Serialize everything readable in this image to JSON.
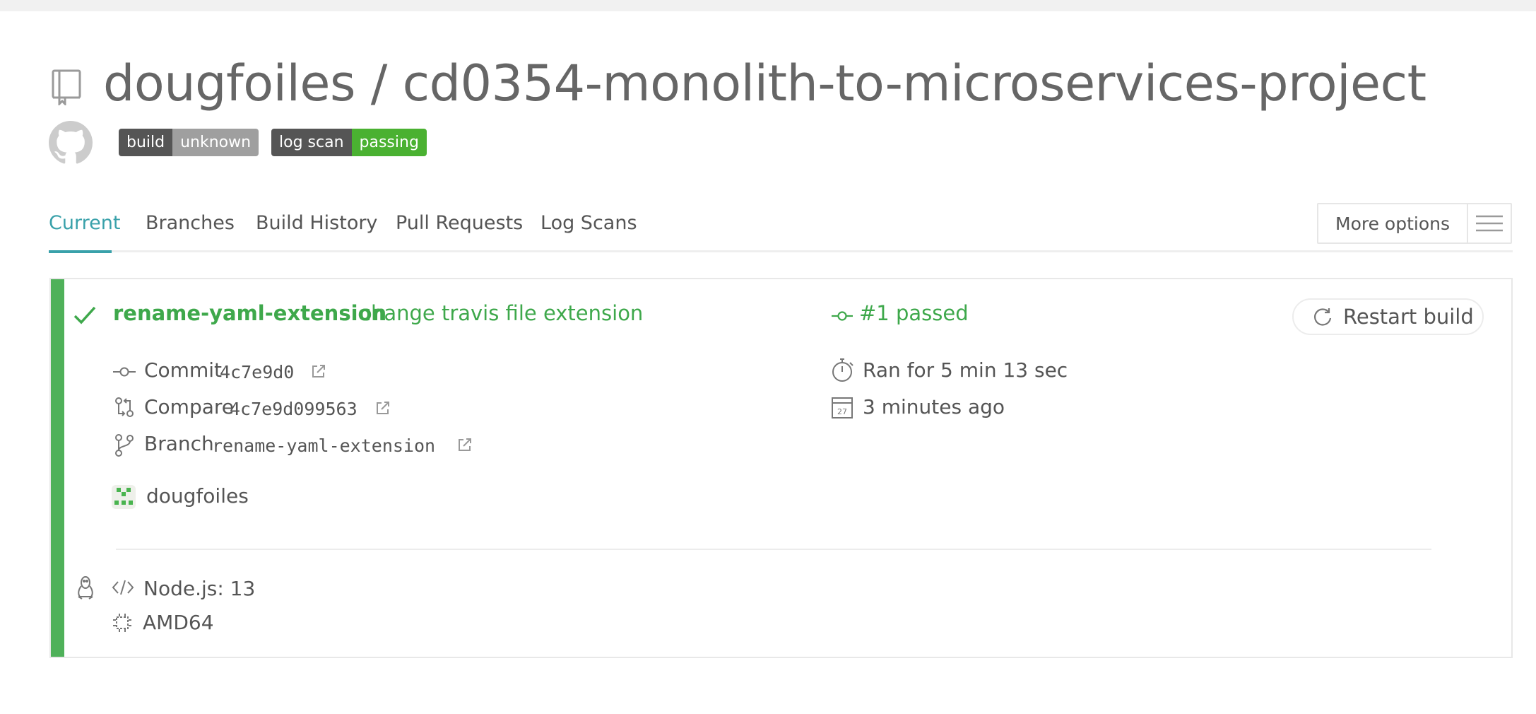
{
  "repo": {
    "owner": "dougfoiles",
    "separator": "/",
    "name": "cd0354-monolith-to-microservices-project"
  },
  "badges": {
    "build": {
      "label": "build",
      "status": "unknown"
    },
    "log_scan": {
      "label": "log scan",
      "status": "passing"
    }
  },
  "tabs": [
    "Current",
    "Branches",
    "Build History",
    "Pull Requests",
    "Log Scans"
  ],
  "active_tab": "Current",
  "more_options": {
    "label": "More options"
  },
  "build": {
    "branch": "rename-yaml-extension",
    "message": "change travis file extension",
    "number_status": "#1 passed",
    "restart_label": "Restart build",
    "commit": {
      "label": "Commit",
      "sha": "4c7e9d0"
    },
    "compare": {
      "label": "Compare",
      "range": "4c7e9d099563"
    },
    "branch_link": {
      "label": "Branch",
      "name": "rename-yaml-extension"
    },
    "author": "dougfoiles",
    "duration": "Ran for 5 min 13 sec",
    "finished": "3 minutes ago",
    "language": "Node.js: 13",
    "arch": "AMD64"
  },
  "colors": {
    "accent": "#39a1aa",
    "passed": "#3ea84b",
    "stripe": "#4fb15a",
    "badge_dark": "#555555",
    "badge_unknown": "#9f9f9f",
    "badge_passing": "#4ab131"
  },
  "icons": [
    "repo-icon",
    "github-icon",
    "check-icon",
    "commit-icon",
    "compare-icon",
    "branch-icon",
    "external-link-icon",
    "stopwatch-icon",
    "calendar-icon",
    "restart-icon",
    "hamburger-icon",
    "linux-icon",
    "code-icon",
    "cpu-icon",
    "avatar"
  ]
}
